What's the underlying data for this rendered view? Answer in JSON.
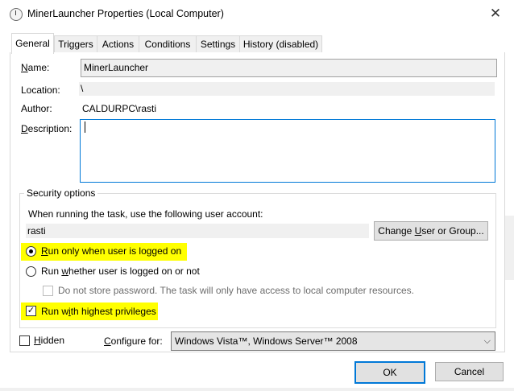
{
  "window": {
    "title": "MinerLauncher Properties (Local Computer)",
    "close_glyph": "✕"
  },
  "tabs": [
    {
      "label": "General",
      "active": true
    },
    {
      "label": "Triggers"
    },
    {
      "label": "Actions"
    },
    {
      "label": "Conditions"
    },
    {
      "label": "Settings"
    },
    {
      "label": "History (disabled)"
    }
  ],
  "general": {
    "name_label": "Name:",
    "name_value": "MinerLauncher",
    "location_label": "Location:",
    "location_value": "\\",
    "author_label": "Author:",
    "author_value": "CALDURPC\\rasti",
    "description_label": "Description:",
    "description_value": ""
  },
  "security": {
    "group_title": "Security options",
    "account_prompt": "When running the task, use the following user account:",
    "user_account": "rasti",
    "change_button": "Change User or Group...",
    "radio_logged_on": "Run only when user is logged on",
    "radio_whether": "Run whether user is logged on or not",
    "no_store_password": "Do not store password.  The task will only have access to local computer resources.",
    "highest_privileges": "Run with highest privileges",
    "highlight_color": "#ffff00"
  },
  "footer": {
    "hidden_label": "Hidden",
    "configure_label": "Configure for:",
    "configure_value": "Windows Vista™, Windows Server™ 2008",
    "ok_button": "OK",
    "cancel_button": "Cancel"
  }
}
